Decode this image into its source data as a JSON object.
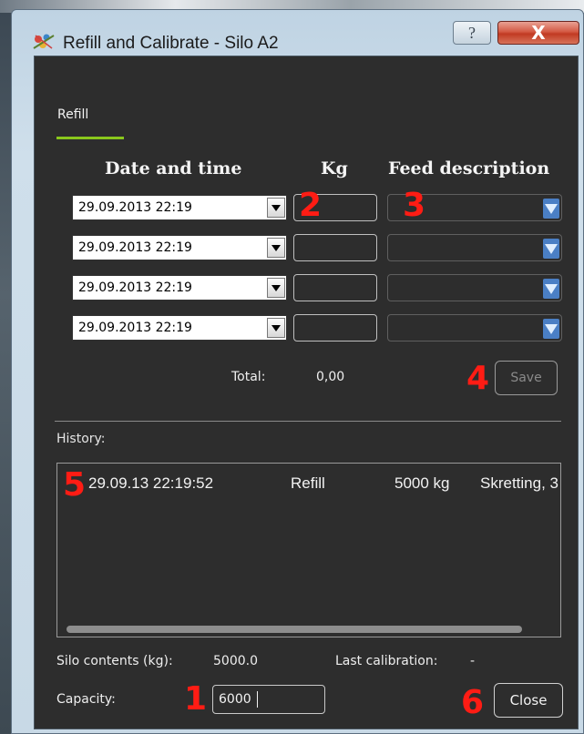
{
  "window": {
    "title": "Refill and Calibrate - Silo A2",
    "help_glyph": "?",
    "close_glyph": "X"
  },
  "tabs": [
    {
      "label": "Refill",
      "active": true
    }
  ],
  "columns": {
    "date": "Date and time",
    "kg": "Kg",
    "feed": "Feed description"
  },
  "rows": [
    {
      "date": "29.09.2013 22:19",
      "kg": "",
      "feed": ""
    },
    {
      "date": "29.09.2013 22:19",
      "kg": "",
      "feed": ""
    },
    {
      "date": "29.09.2013 22:19",
      "kg": "",
      "feed": ""
    },
    {
      "date": "29.09.2013 22:19",
      "kg": "",
      "feed": ""
    }
  ],
  "total": {
    "label": "Total:",
    "value": "0,00"
  },
  "save_label": "Save",
  "history": {
    "label": "History:",
    "entries": [
      {
        "time": "29.09.13 22:19:52",
        "type": "Refill",
        "amount": "5000 kg",
        "feed": "Skretting, 3"
      }
    ]
  },
  "silo": {
    "contents_label": "Silo contents (kg):",
    "contents_value": "5000.0",
    "last_calibration_label": "Last calibration:",
    "last_calibration_value": "-",
    "capacity_label": "Capacity:",
    "capacity_value": "6000"
  },
  "close_label": "Close",
  "markers": {
    "m1": "1",
    "m2": "2",
    "m3": "3",
    "m4": "4",
    "m5": "5",
    "m6": "6"
  },
  "colors": {
    "accent": "#8ac71c",
    "marker": "#ff1c14",
    "dialog_bg": "#2d2d2d"
  }
}
